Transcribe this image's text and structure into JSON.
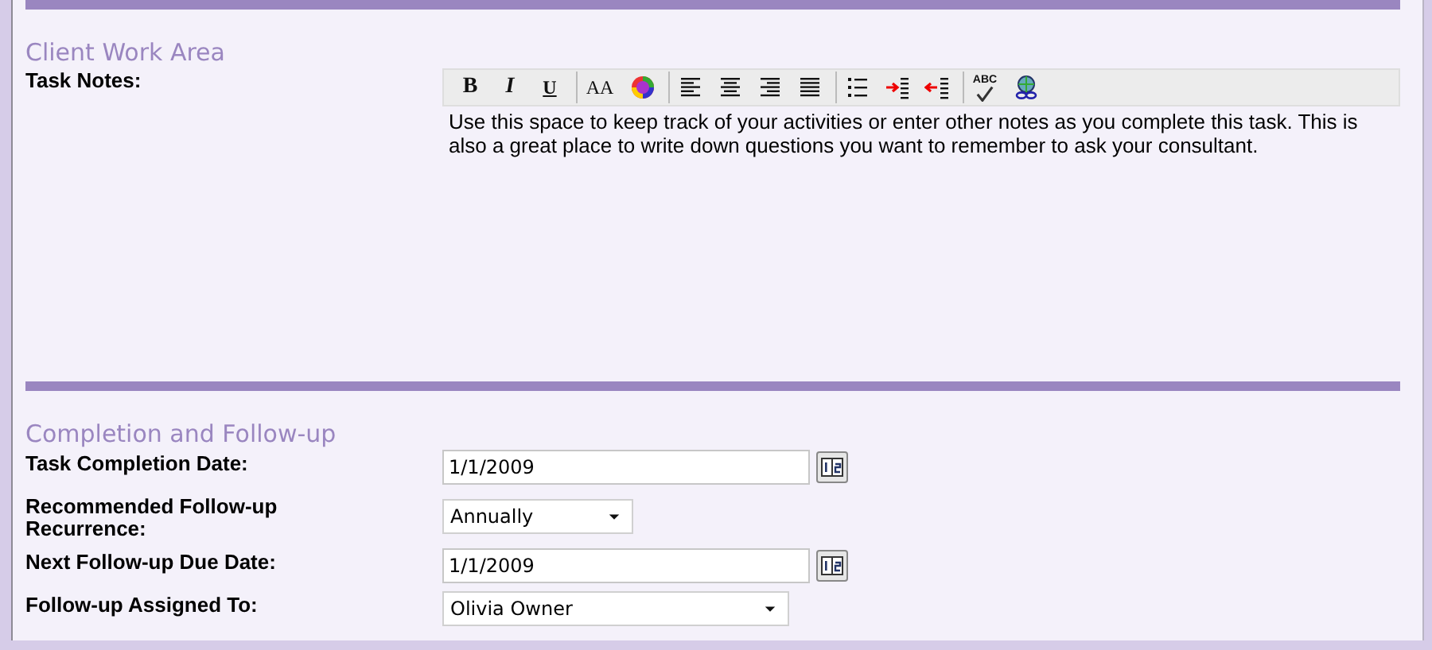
{
  "sections": [
    {
      "kind": "notes",
      "title": "Client Work Area",
      "label": "Task Notes:",
      "toolbar": [
        [
          {
            "kind": "bold",
            "label": "B"
          },
          {
            "kind": "italic",
            "label": "I"
          },
          {
            "kind": "underline",
            "label": "U"
          }
        ],
        [
          {
            "kind": "font-size",
            "label": "AA"
          },
          {
            "kind": "color"
          }
        ],
        [
          {
            "kind": "align-left"
          },
          {
            "kind": "align-center"
          },
          {
            "kind": "align-right"
          },
          {
            "kind": "justify"
          }
        ],
        [
          {
            "kind": "list"
          },
          {
            "kind": "indent"
          },
          {
            "kind": "outdent"
          }
        ],
        [
          {
            "kind": "spellcheck",
            "label": "ABC"
          },
          {
            "kind": "link"
          }
        ]
      ],
      "text": "Use this space to keep track of your activities or enter other notes as you complete this task. This is also a great place to write down questions you want to remember to ask your consultant."
    },
    {
      "kind": "form",
      "title": "Completion and Follow-up",
      "fields": [
        {
          "kind": "date",
          "label": "Task Completion Date:",
          "value": "1/1/2009"
        },
        {
          "kind": "select",
          "label": "Recommended Follow-up Recurrence:",
          "value": "Annually"
        },
        {
          "kind": "date",
          "label": "Next Follow-up Due Date:",
          "value": "1/1/2009"
        },
        {
          "kind": "select",
          "label": "Follow-up Assigned To:",
          "value": "Olivia Owner"
        }
      ]
    }
  ]
}
